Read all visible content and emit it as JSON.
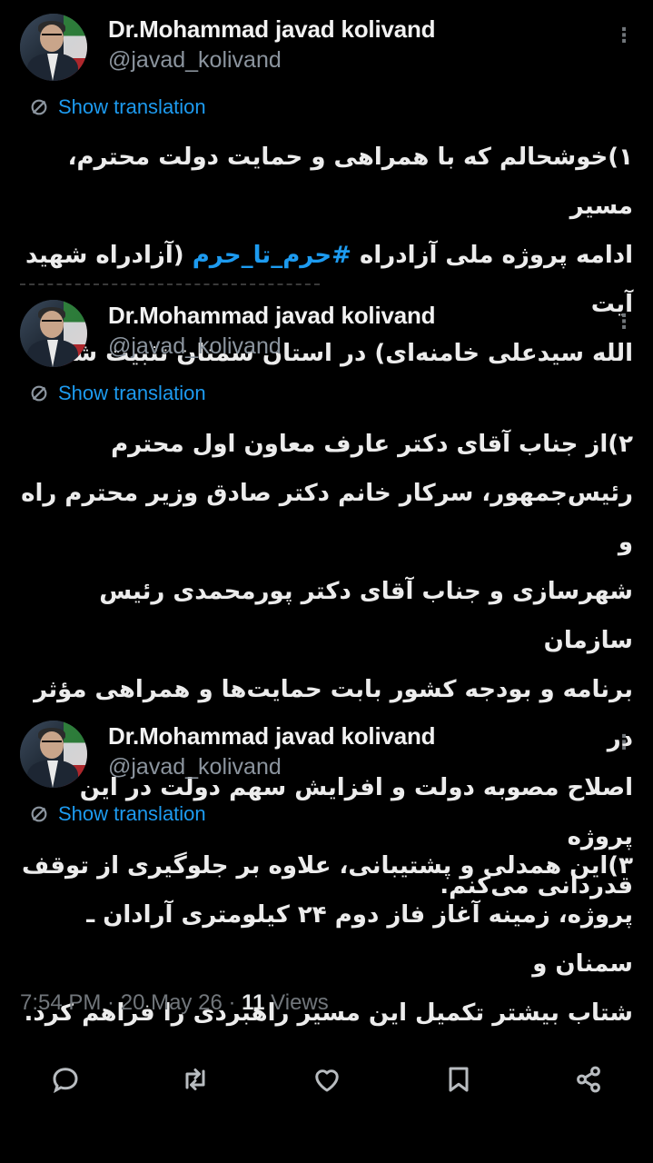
{
  "tweets": [
    {
      "author_name": "Dr.Mohammad javad kolivand",
      "handle": "@javad_kolivand",
      "more_icon": "⋮",
      "translate_label": "Show translation",
      "lines": [
        "۱)خوشحالم که با همراهی و حمایت دولت محترم، مسیر",
        "ادامه پروژه ملی آزادراه",
        "(آزادراه شهید آیت",
        "الله سیدعلی خامنه‌ای) در استان سمنان تثبیت شد."
      ],
      "hashtag": "#حرم_تا_حرم"
    },
    {
      "author_name": "Dr.Mohammad javad kolivand",
      "handle": "@javad_kolivand",
      "more_icon": "⋮",
      "translate_label": "Show translation",
      "lines": [
        "۲)از جناب آقای دکتر عارف معاون اول محترم",
        "رئیس‌جمهور، سرکار خانم دکتر صادق وزیر محترم راه و",
        "شهرسازی و جناب آقای دکتر پورمحمدی رئیس سازمان",
        "برنامه و بودجه کشور بابت حمایت‌ها و همراهی مؤثر در",
        "اصلاح مصوبه دولت و افزایش سهم دولت در این پروژه",
        "قدردانی می‌کنم."
      ]
    },
    {
      "author_name": "Dr.Mohammad javad kolivand",
      "handle": "@javad_kolivand",
      "more_icon": "⋮",
      "translate_label": "Show translation",
      "lines": [
        "۳)این همدلی و پشتیبانی، علاوه بر جلوگیری از توقف",
        "پروژه، زمینه آغاز فاز دوم ۲۴ کیلومتری آرادان ـ سمنان و",
        "شتاب بیشتر تکمیل این مسیر راهبردی را فراهم کرد."
      ]
    }
  ],
  "meta": {
    "time": "7:54 PM",
    "dot1": " · ",
    "date": "20 May 26",
    "dot2": " · ",
    "views_count": "11",
    "views_label": " Views"
  },
  "actions": {
    "icons": [
      "reply-icon",
      "retweet-icon",
      "like-icon",
      "bookmark-icon",
      "share-icon"
    ]
  },
  "colors": {
    "background": "#000000",
    "accent": "#1d9bf0",
    "text": "#e7e9ea",
    "muted": "#71767b"
  }
}
